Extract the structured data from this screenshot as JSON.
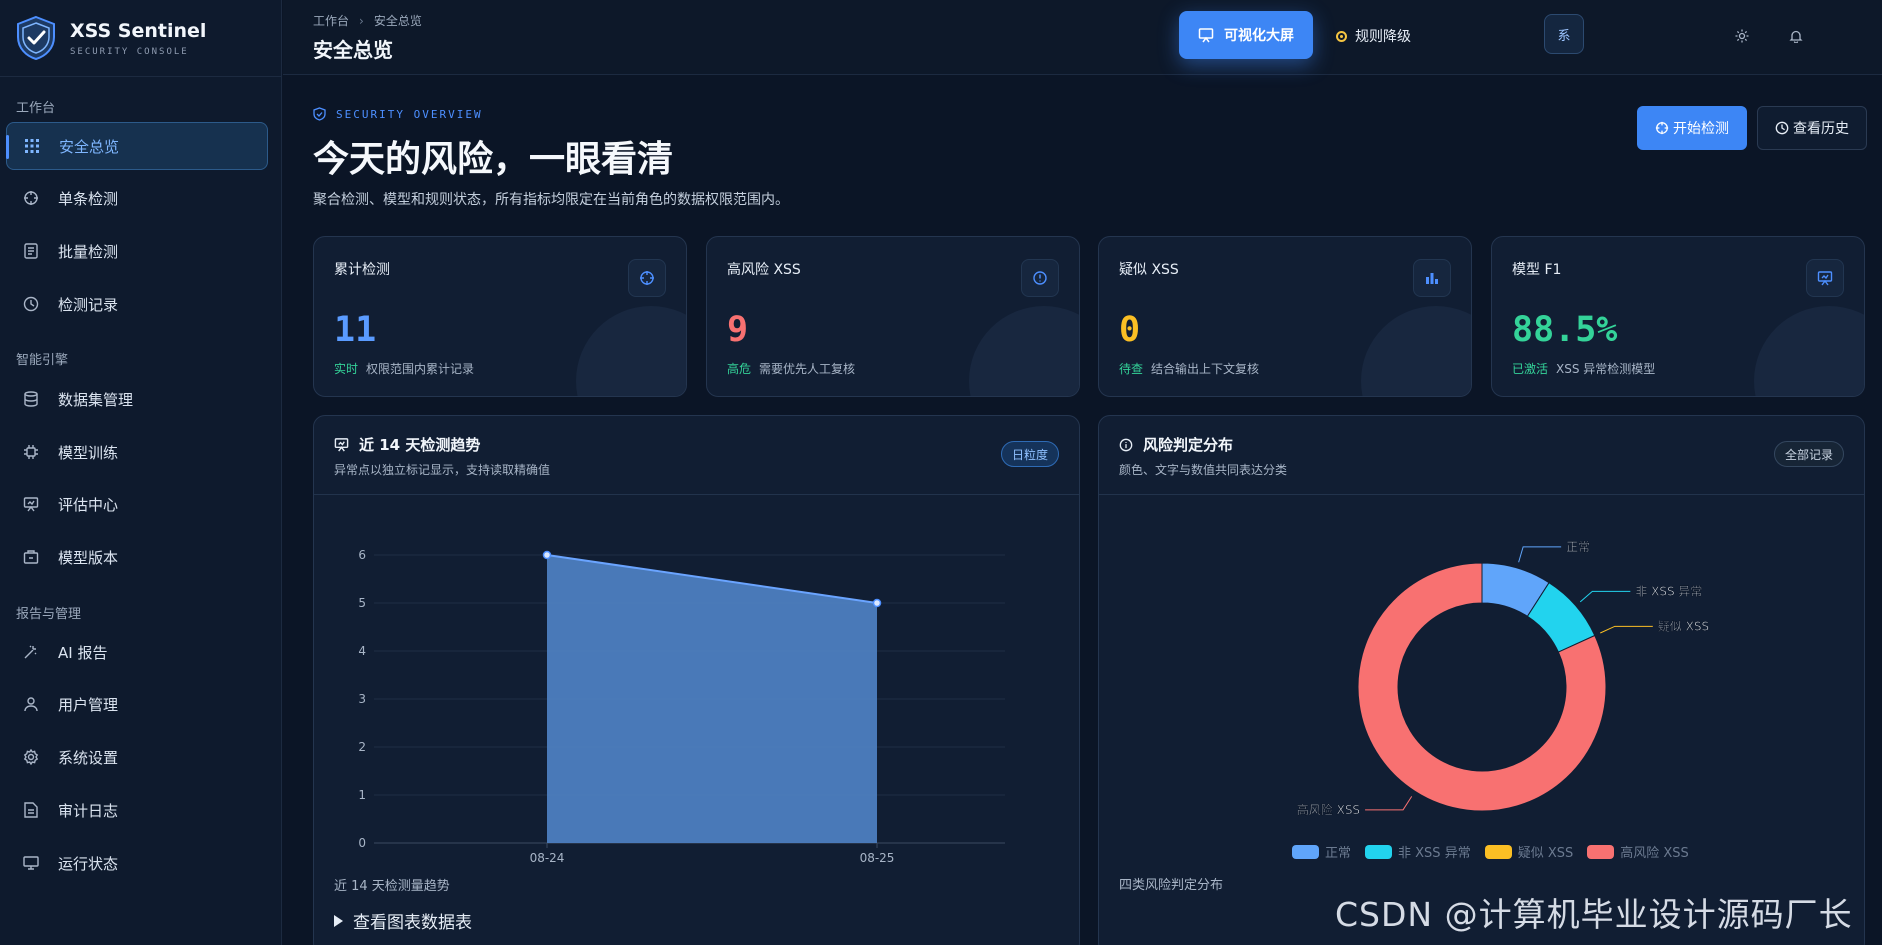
{
  "brand": {
    "name": "XSS Sentinel",
    "subtitle": "SECURITY CONSOLE"
  },
  "sidebar": {
    "groups": [
      {
        "title": "工作台"
      },
      {
        "title": "智能引擎"
      },
      {
        "title": "报告与管理"
      }
    ],
    "items": [
      {
        "label": "安全总览",
        "icon": "grid-icon",
        "active": true
      },
      {
        "label": "单条检测",
        "icon": "crosshair-icon"
      },
      {
        "label": "批量检测",
        "icon": "document-icon"
      },
      {
        "label": "检测记录",
        "icon": "clock-icon"
      },
      {
        "label": "数据集管理",
        "icon": "database-icon"
      },
      {
        "label": "模型训练",
        "icon": "chip-icon"
      },
      {
        "label": "评估中心",
        "icon": "presentation-icon"
      },
      {
        "label": "模型版本",
        "icon": "package-icon"
      },
      {
        "label": "AI 报告",
        "icon": "sparkle-icon"
      },
      {
        "label": "用户管理",
        "icon": "user-icon"
      },
      {
        "label": "系统设置",
        "icon": "gear-icon"
      },
      {
        "label": "审计日志",
        "icon": "file-text-icon"
      },
      {
        "label": "运行状态",
        "icon": "monitor-icon"
      }
    ]
  },
  "topbar": {
    "breadcrumb": [
      "工作台",
      "安全总览"
    ],
    "title": "安全总览",
    "screen_button": "可视化大屏",
    "rule_status": "规则降级",
    "avatar": "系"
  },
  "hero": {
    "tag": "SECURITY OVERVIEW",
    "title": "今天的风险，一眼看清",
    "subtitle": "聚合检测、模型和规则状态，所有指标均限定在当前角色的数据权限范围内。",
    "start_button": "开始检测",
    "history_button": "查看历史"
  },
  "stats": [
    {
      "label": "累计检测",
      "value": "11",
      "color": "#5a9bff",
      "tag": "实时",
      "desc": "权限范围内累计记录",
      "icon": "crosshair-icon"
    },
    {
      "label": "高风险 XSS",
      "value": "9",
      "color": "#f87171",
      "tag": "高危",
      "desc": "需要优先人工复核",
      "icon": "alert-circle-icon"
    },
    {
      "label": "疑似 XSS",
      "value": "0",
      "color": "#fbbf24",
      "tag": "待查",
      "desc": "结合输出上下文复核",
      "icon": "bar-chart-icon"
    },
    {
      "label": "模型 F1",
      "value": "88.5%",
      "color": "#34d399",
      "tag": "已激活",
      "desc": "XSS 异常检测模型",
      "icon": "presentation-icon"
    }
  ],
  "trend_panel": {
    "title": "近 14 天检测趋势",
    "subtitle": "异常点以独立标记显示，支持读取精确值",
    "pill": "日粒度",
    "caption": "近 14 天检测量趋势",
    "table_toggle": "查看图表数据表"
  },
  "risk_panel": {
    "title": "风险判定分布",
    "subtitle": "颜色、文字与数值共同表达分类",
    "pill": "全部记录",
    "caption": "四类风险判定分布"
  },
  "chart_data": [
    {
      "type": "area",
      "x": [
        "08-24",
        "08-25"
      ],
      "series": [
        {
          "values": [
            6,
            5
          ]
        }
      ],
      "ylim": [
        0,
        6
      ],
      "yticks": [
        0,
        1,
        2,
        3,
        4,
        5,
        6
      ],
      "color": "#4d7ec0",
      "grid": true
    },
    {
      "type": "pie",
      "donut": true,
      "categories": [
        "正常",
        "非 XSS 异常",
        "疑似 XSS",
        "高风险 XSS"
      ],
      "values": [
        1,
        1,
        0,
        9
      ],
      "colors": [
        "#60a5fa",
        "#22d3ee",
        "#fbbf24",
        "#f87171"
      ],
      "legend": "bottom"
    }
  ],
  "watermark": "CSDN @计算机毕业设计源码厂长"
}
